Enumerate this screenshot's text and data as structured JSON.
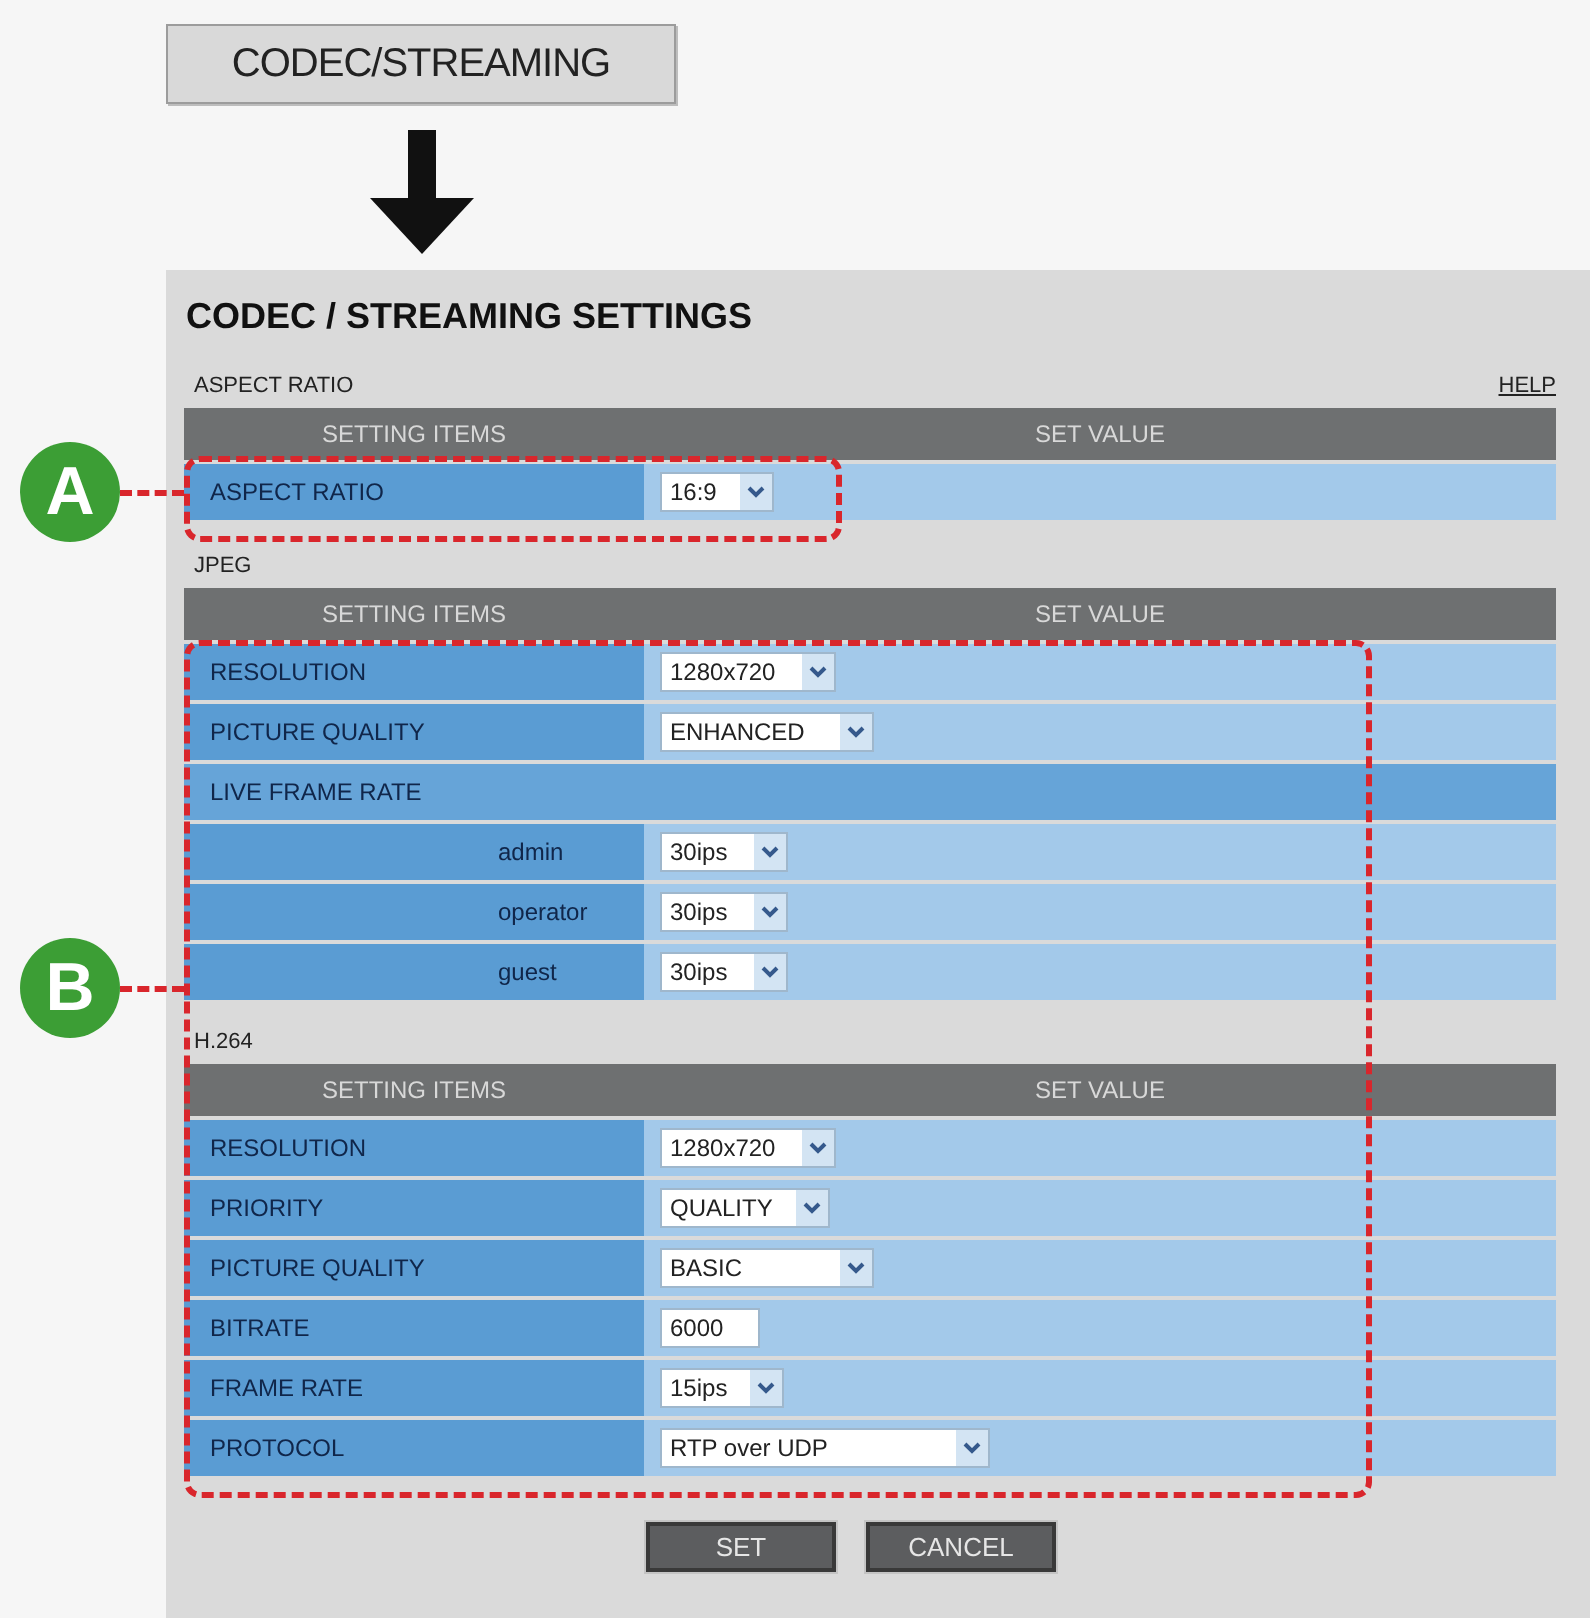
{
  "menu_button": {
    "label": "CODEC/STREAMING"
  },
  "panel": {
    "title": "CODEC / STREAMING SETTINGS",
    "sections": [
      {
        "title": "ASPECT RATIO",
        "help": "HELP",
        "columns": [
          "SETTING ITEMS",
          "SET VALUE"
        ],
        "rows": [
          {
            "kind": "select",
            "label": "ASPECT RATIO",
            "value": "16:9"
          }
        ]
      },
      {
        "title": "JPEG",
        "columns": [
          "SETTING ITEMS",
          "SET VALUE"
        ],
        "rows": [
          {
            "kind": "select",
            "label": "RESOLUTION",
            "value": "1280x720"
          },
          {
            "kind": "select",
            "label": "PICTURE QUALITY",
            "value": "ENHANCED"
          },
          {
            "kind": "group",
            "label": "LIVE FRAME RATE"
          },
          {
            "kind": "sub_select",
            "label": "admin",
            "value": "30ips"
          },
          {
            "kind": "sub_select",
            "label": "operator",
            "value": "30ips"
          },
          {
            "kind": "sub_select",
            "label": "guest",
            "value": "30ips"
          }
        ]
      },
      {
        "title": "H.264",
        "columns": [
          "SETTING ITEMS",
          "SET VALUE"
        ],
        "rows": [
          {
            "kind": "select",
            "label": "RESOLUTION",
            "value": "1280x720"
          },
          {
            "kind": "select",
            "label": "PRIORITY",
            "value": "QUALITY"
          },
          {
            "kind": "select",
            "label": "PICTURE QUALITY",
            "value": "BASIC"
          },
          {
            "kind": "input",
            "label": "BITRATE",
            "value": "6000"
          },
          {
            "kind": "select",
            "label": "FRAME RATE",
            "value": "15ips"
          },
          {
            "kind": "select",
            "label": "PROTOCOL",
            "value": "RTP over UDP"
          }
        ]
      }
    ],
    "buttons": [
      {
        "label": "SET"
      },
      {
        "label": "CANCEL"
      }
    ]
  },
  "callouts": [
    {
      "label": "A"
    },
    {
      "label": "B"
    }
  ]
}
